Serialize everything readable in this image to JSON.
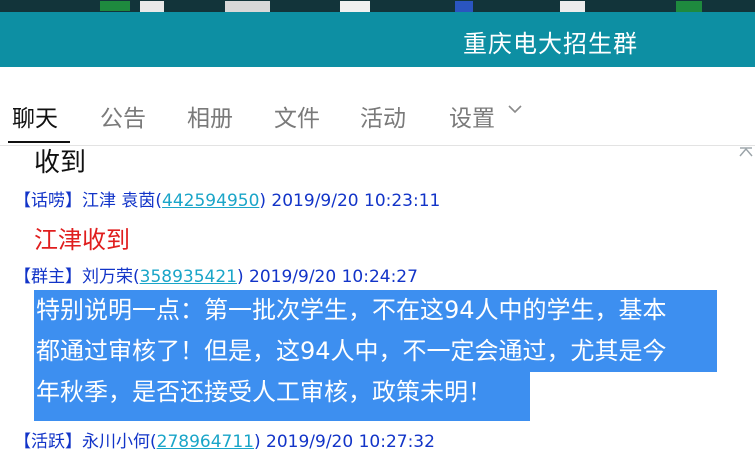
{
  "window": {
    "title": "重庆电大招生群"
  },
  "tabs": [
    "聊天",
    "公告",
    "相册",
    "文件",
    "活动",
    "设置"
  ],
  "active_tab": "聊天",
  "messages": {
    "m1_text": "收到",
    "m2_header": {
      "badge": "【话唠】",
      "name": "江津  袁茵(",
      "qq": "442594950",
      "time": ") 2019/9/20 10:23:11"
    },
    "m2_text": "江津收到",
    "m3_header": {
      "badge": "【群主】",
      "name": "刘万荣(",
      "qq": "358935421",
      "time": ") 2019/9/20 10:24:27"
    },
    "m3_lines": [
      "特别说明一点：第一批次学生，不在这94人中的学生，基本",
      "都通过审核了！但是，这94人中，不一定会通过，尤其是今",
      "年秋季，是否还接受人工审核，政策未明！"
    ],
    "m4_header": {
      "badge": "【活跃】",
      "name": "永川小何(",
      "qq": "278964711",
      "time": ") 2019/9/20 10:27:32"
    }
  },
  "colors": {
    "titlebar": "#0d8fa3",
    "selection": "#3d8ff0",
    "header_blue": "#1234c8",
    "link_cyan": "#1aa5c8",
    "red_text": "#e01e1e"
  }
}
